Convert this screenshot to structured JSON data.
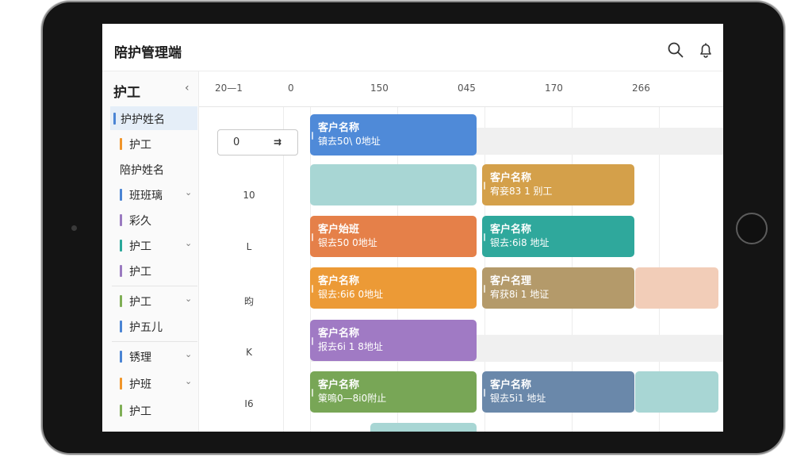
{
  "app": {
    "title": "陪护管理端"
  },
  "sidebar": {
    "header": "护工",
    "collapse_glyph": "‹",
    "items": [
      {
        "label": "护护姓名",
        "color": "#4a84d4",
        "active": true,
        "chevron": false
      },
      {
        "label": "护工",
        "color": "#f0952a",
        "active": false,
        "chevron": false
      },
      {
        "label": "陪护姓名",
        "color": "",
        "active": false,
        "chevron": false,
        "plain": true
      },
      {
        "label": "班班璃",
        "color": "#4a84d4",
        "active": false,
        "chevron": true
      },
      {
        "label": "彩久",
        "color": "#9a7ac0",
        "active": false,
        "chevron": false
      },
      {
        "label": "护工",
        "color": "#2aa89a",
        "active": false,
        "chevron": true
      },
      {
        "label": "护工",
        "color": "#9a7ac0",
        "active": false,
        "chevron": false
      },
      {
        "label": "护工",
        "color": "#7fae55",
        "active": false,
        "chevron": true
      },
      {
        "label": "护五儿",
        "color": "#4a84d4",
        "active": false,
        "chevron": false
      },
      {
        "label": "锈理",
        "color": "#4a84d4",
        "active": false,
        "chevron": true
      },
      {
        "label": "护班",
        "color": "#f0952a",
        "active": false,
        "chevron": true
      },
      {
        "label": "护工",
        "color": "#7fae55",
        "active": false,
        "chevron": false
      }
    ]
  },
  "ruler": {
    "ticks": [
      "20—1",
      "0",
      "150",
      "045",
      "170",
      "266"
    ]
  },
  "rows": {
    "field": {
      "value": "0",
      "suffix": "⇉"
    },
    "labels": [
      "10",
      "L",
      "昀",
      "K",
      "I6"
    ]
  },
  "cards": [
    {
      "title": "客户名称",
      "sub": "镇去50\\ 0地址",
      "color": "#4f8ad8"
    },
    {
      "title": "",
      "sub": "",
      "color": "#a8d6d4"
    },
    {
      "title": "客户名称",
      "sub": "宥妾83 1 别工",
      "color": "#d4a04a"
    },
    {
      "title": "客户始班",
      "sub": "银去50 0地址",
      "color": "#e58049"
    },
    {
      "title": "客户名称",
      "sub": "银去:6i8 地址",
      "color": "#2fa89c"
    },
    {
      "title": "客户名称",
      "sub": "银去:6i6 0地址",
      "color": "#ec9a36"
    },
    {
      "title": "客户名理",
      "sub": "宥获8i 1 地证",
      "color": "#b49a6a"
    },
    {
      "title": "",
      "sub": "",
      "color": "#f2cdb8"
    },
    {
      "title": "客户名称",
      "sub": "报去6i 1 8地址",
      "color": "#a07ac4"
    },
    {
      "title": "客户名称",
      "sub": "䇿嗚0—8i0附止",
      "color": "#78a656"
    },
    {
      "title": "客户名称",
      "sub": "银去5i1 地址",
      "color": "#6a88aa"
    },
    {
      "title": "",
      "sub": "",
      "color": "#a8d6d4"
    },
    {
      "title": "",
      "sub": "",
      "color": "#a8d6d4"
    }
  ],
  "icons": {
    "search": "search-icon",
    "bell": "bell-icon"
  }
}
